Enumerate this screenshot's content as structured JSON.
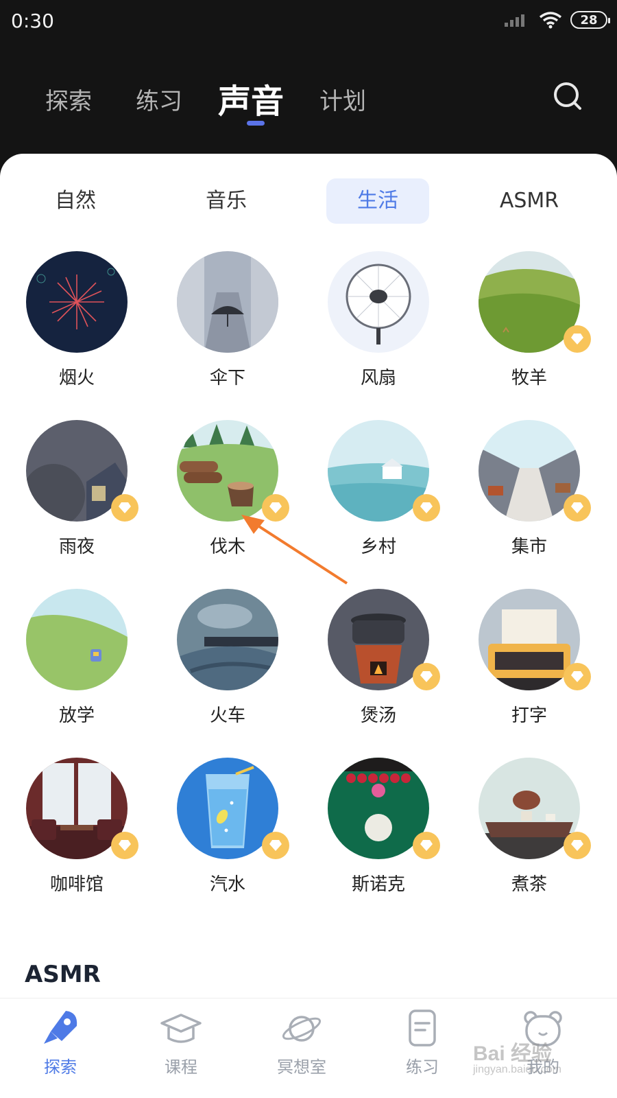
{
  "status_bar": {
    "time": "0:30",
    "battery": "28"
  },
  "header": {
    "tabs": [
      {
        "label": "探索"
      },
      {
        "label": "练习"
      },
      {
        "label": "声音"
      },
      {
        "label": "计划"
      }
    ],
    "active_tab": "声音",
    "search_icon": "search-icon"
  },
  "categories": {
    "tabs": [
      {
        "label": "自然"
      },
      {
        "label": "音乐"
      },
      {
        "label": "生活"
      },
      {
        "label": "ASMR"
      }
    ],
    "active": "生活"
  },
  "sounds": [
    {
      "label": "烟火",
      "vip": false
    },
    {
      "label": "伞下",
      "vip": false
    },
    {
      "label": "风扇",
      "vip": false
    },
    {
      "label": "牧羊",
      "vip": true
    },
    {
      "label": "雨夜",
      "vip": true
    },
    {
      "label": "伐木",
      "vip": true
    },
    {
      "label": "乡村",
      "vip": true
    },
    {
      "label": "集市",
      "vip": true
    },
    {
      "label": "放学",
      "vip": false
    },
    {
      "label": "火车",
      "vip": false
    },
    {
      "label": "煲汤",
      "vip": true
    },
    {
      "label": "打字",
      "vip": true
    },
    {
      "label": "咖啡馆",
      "vip": true
    },
    {
      "label": "汽水",
      "vip": true
    },
    {
      "label": "斯诺克",
      "vip": true
    },
    {
      "label": "煮茶",
      "vip": true
    }
  ],
  "section_heading": "ASMR",
  "bottom_nav": {
    "items": [
      {
        "label": "探索",
        "icon": "rocket-icon"
      },
      {
        "label": "课程",
        "icon": "graduation-cap-icon"
      },
      {
        "label": "冥想室",
        "icon": "planet-icon"
      },
      {
        "label": "练习",
        "icon": "clipboard-icon"
      },
      {
        "label": "我的",
        "icon": "bear-face-icon"
      }
    ],
    "active": "探索"
  },
  "watermark": {
    "brand": "Bai 经验",
    "url": "jingyan.baidu.com"
  },
  "colors": {
    "accent": "#4e7ae6",
    "header_bg": "#141414",
    "vip_badge": "#f8c45a",
    "annotation_arrow": "#f27b2e"
  }
}
